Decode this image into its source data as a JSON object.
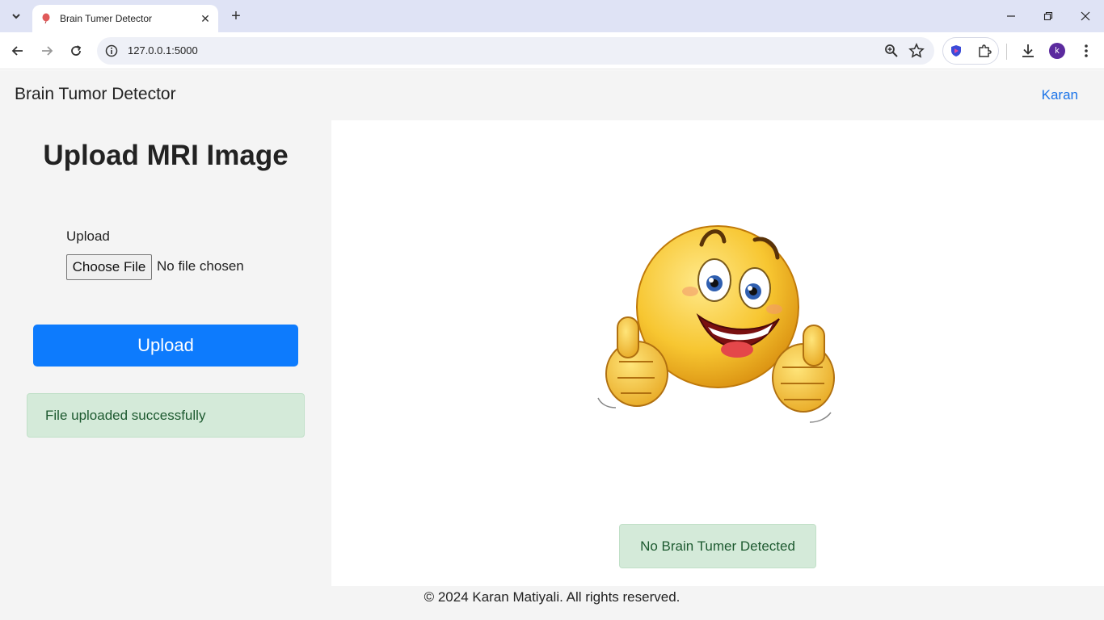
{
  "browser": {
    "tab_title": "Brain Tumer Detector",
    "url": "127.0.0.1:5000",
    "avatar_letter": "k"
  },
  "navbar": {
    "brand": "Brain Tumor Detector",
    "link": "Karan"
  },
  "sidebar": {
    "heading": "Upload MRI Image",
    "upload_label": "Upload",
    "choose_file": "Choose File",
    "no_file": "No file chosen",
    "upload_button": "Upload",
    "success_message": "File uploaded successfully"
  },
  "main": {
    "result_message": "No Brain Tumer Detected",
    "image": "thumbs-up-smiley-emoji"
  },
  "footer": {
    "text": "© 2024 Karan Matiyali. All rights reserved."
  },
  "colors": {
    "primary": "#0d7bfd",
    "success_bg": "#d4ead9",
    "link": "#1a73e8"
  }
}
